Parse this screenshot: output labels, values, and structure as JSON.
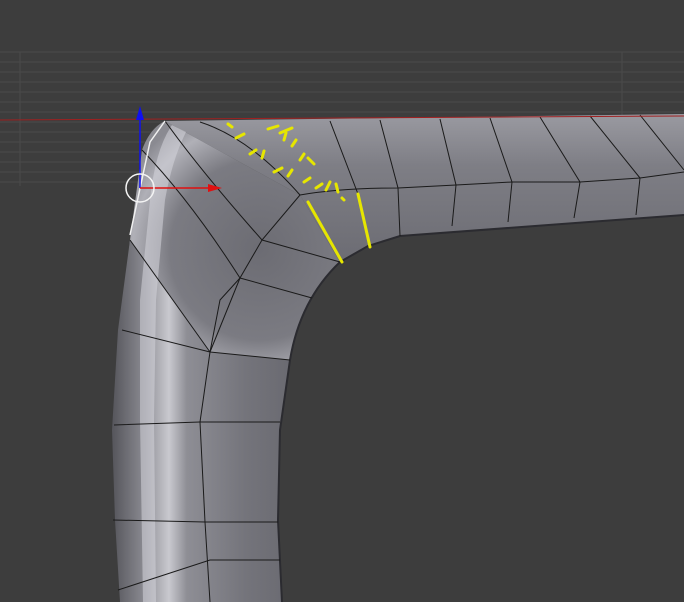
{
  "app": {
    "view": "3d-viewport",
    "mode": "edit-mode",
    "background_color": "#3d3d3d"
  },
  "scene": {
    "object": "mesh-bend",
    "shading": "solid",
    "surface_color": "#76767d",
    "wire_color": "#1a1a1a",
    "selection_color": "#e6e600"
  },
  "gizmo": {
    "x_axis_color": "#e01010",
    "z_axis_color": "#1010f0",
    "cursor_icon": "3d-cursor-icon"
  },
  "annotation": {
    "color": "#e6e600",
    "type": "hand-drawn loop-cut marks"
  }
}
